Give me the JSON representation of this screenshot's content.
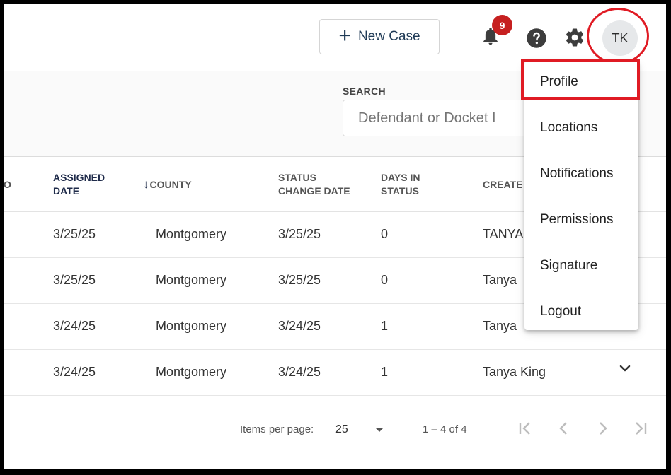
{
  "header": {
    "new_case_label": "New Case",
    "notification_count": "9",
    "avatar_initials": "TK"
  },
  "search": {
    "label": "SEARCH",
    "placeholder": "Defendant or Docket I"
  },
  "table": {
    "columns": {
      "partial_left": "O",
      "assigned_date_1": "ASSIGNED",
      "assigned_date_2": "DATE",
      "county": "COUNTY",
      "status_change_1": "STATUS",
      "status_change_2": "CHANGE DATE",
      "days_in_status_1": "DAYS IN",
      "days_in_status_2": "STATUS",
      "created_by": "CREATE"
    },
    "rows": [
      {
        "assigned_date": "3/25/25",
        "county": "Montgomery",
        "status_change_date": "3/25/25",
        "days_in_status": "0",
        "created_by": "TANYA"
      },
      {
        "assigned_date": "3/25/25",
        "county": "Montgomery",
        "status_change_date": "3/25/25",
        "days_in_status": "0",
        "created_by": "Tanya"
      },
      {
        "assigned_date": "3/24/25",
        "county": "Montgomery",
        "status_change_date": "3/24/25",
        "days_in_status": "1",
        "created_by": "Tanya"
      },
      {
        "assigned_date": "3/24/25",
        "county": "Montgomery",
        "status_change_date": "3/24/25",
        "days_in_status": "1",
        "created_by": "Tanya King"
      }
    ]
  },
  "pagination": {
    "items_per_page_label": "Items per page:",
    "items_per_page_value": "25",
    "range_label": "1 – 4 of 4"
  },
  "user_menu": {
    "items": [
      {
        "label": "Profile"
      },
      {
        "label": "Locations"
      },
      {
        "label": "Notifications"
      },
      {
        "label": "Permissions"
      },
      {
        "label": "Signature"
      },
      {
        "label": "Logout"
      }
    ]
  },
  "colors": {
    "accent_navy": "#1f2b4a",
    "badge_red": "#c62020",
    "highlight_red": "#e01b24",
    "icon_gray": "#3d3d3d"
  }
}
